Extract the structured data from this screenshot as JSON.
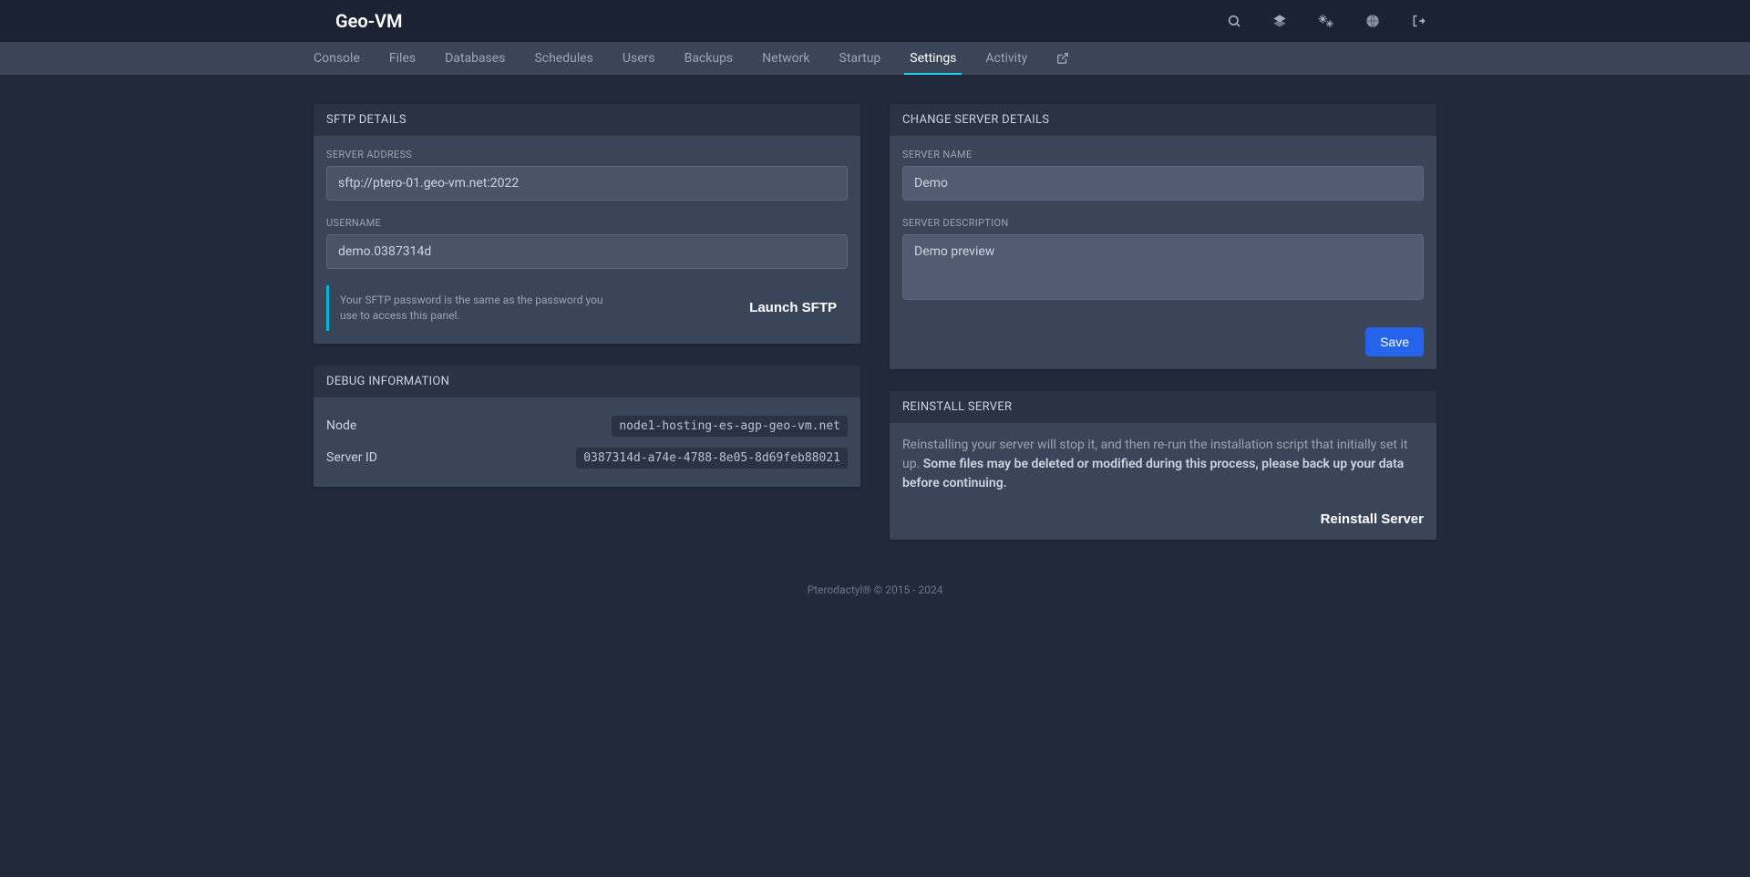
{
  "brand": "Geo-VM",
  "nav": {
    "items": [
      {
        "label": "Console"
      },
      {
        "label": "Files"
      },
      {
        "label": "Databases"
      },
      {
        "label": "Schedules"
      },
      {
        "label": "Users"
      },
      {
        "label": "Backups"
      },
      {
        "label": "Network"
      },
      {
        "label": "Startup"
      },
      {
        "label": "Settings"
      },
      {
        "label": "Activity"
      }
    ],
    "active_index": 8
  },
  "sftp": {
    "title": "SFTP DETAILS",
    "address_label": "SERVER ADDRESS",
    "address_value": "sftp://ptero-01.geo-vm.net:2022",
    "username_label": "USERNAME",
    "username_value": "demo.0387314d",
    "note": "Your SFTP password is the same as the password you use to access this panel.",
    "launch_label": "Launch SFTP"
  },
  "debug": {
    "title": "DEBUG INFORMATION",
    "rows": [
      {
        "label": "Node",
        "value": "node1-hosting-es-agp-geo-vm.net"
      },
      {
        "label": "Server ID",
        "value": "0387314d-a74e-4788-8e05-8d69feb88021"
      }
    ]
  },
  "change": {
    "title": "CHANGE SERVER DETAILS",
    "name_label": "SERVER NAME",
    "name_value": "Demo",
    "desc_label": "SERVER DESCRIPTION",
    "desc_value": "Demo preview",
    "save_label": "Save"
  },
  "reinstall": {
    "title": "REINSTALL SERVER",
    "text_lead": "Reinstalling your server will stop it, and then re-run the installation script that initially set it up. ",
    "text_bold": "Some files may be deleted or modified during this process, please back up your data before continuing.",
    "button_label": "Reinstall Server"
  },
  "footer": "Pterodactyl® © 2015 - 2024"
}
